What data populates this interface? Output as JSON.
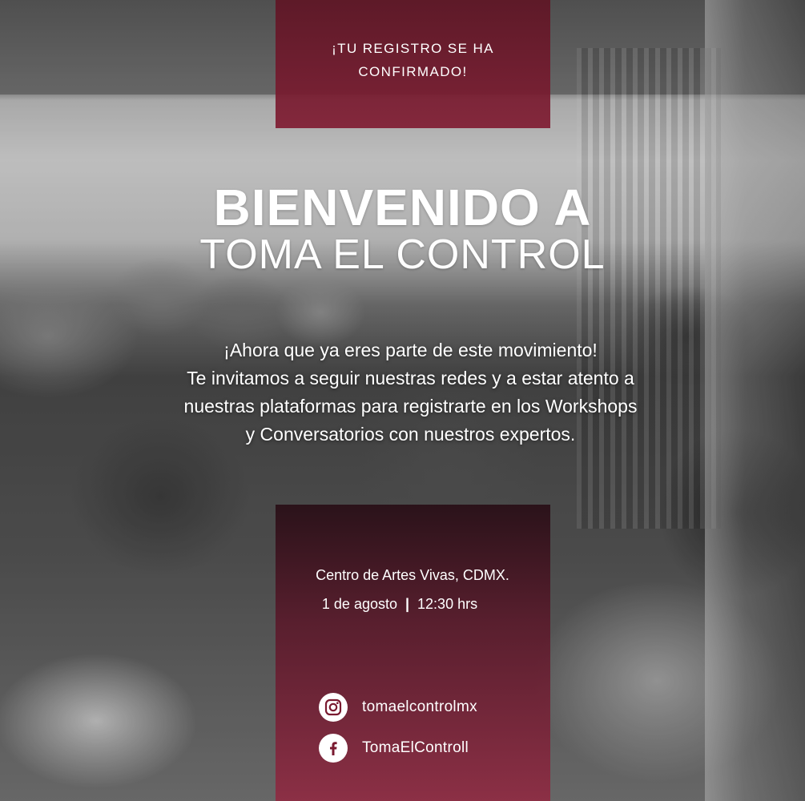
{
  "header": {
    "confirmation_line1": "¡Tu registro se ha",
    "confirmation_line2": "confirmado!"
  },
  "hero": {
    "title_line1": "BIENVENIDO A",
    "title_line2": "TOMA EL CONTROL"
  },
  "message": {
    "line1": "¡Ahora que ya eres parte de este movimiento!",
    "line2": "Te invitamos a seguir nuestras redes y a estar atento a",
    "line3": "nuestras plataformas para registrarte en los Workshops",
    "line4": "y Conversatorios con nuestros expertos."
  },
  "event": {
    "venue": "Centro de Artes Vivas, CDMX.",
    "date": "1 de agosto",
    "separator": "|",
    "time": "12:30 hrs"
  },
  "social": {
    "instagram": {
      "icon": "instagram-icon",
      "handle": "tomaelcontrolmx"
    },
    "facebook": {
      "icon": "facebook-icon",
      "handle": "TomaElControll"
    }
  },
  "colors": {
    "panel": "#7a1a30",
    "text": "#ffffff"
  }
}
